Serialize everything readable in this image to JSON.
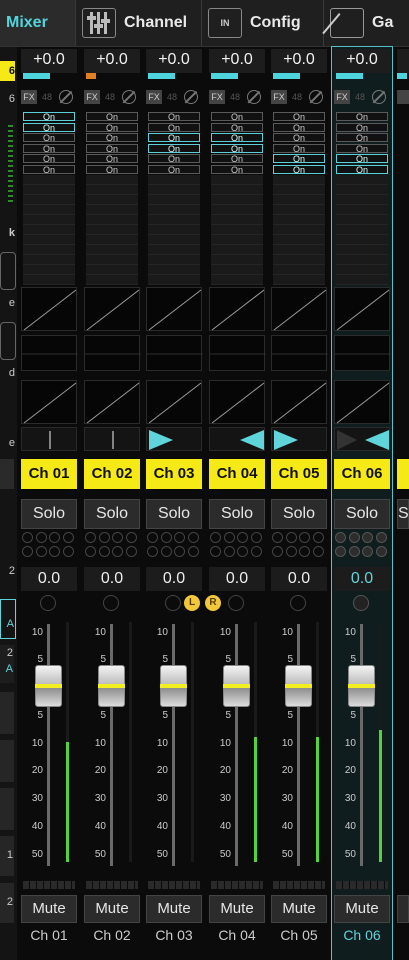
{
  "tabs": [
    {
      "label": "Mixer",
      "icon": "mixer-tab",
      "active": true
    },
    {
      "label": "Channel",
      "icon": "channel-faders-icon",
      "active": false
    },
    {
      "label": "Config",
      "icon": "config-in-icon",
      "active": false
    },
    {
      "label": "Ga",
      "icon": "gain-icon",
      "active": false
    }
  ],
  "config_icon_text": "IN",
  "left_strip": {
    "top_value": "6",
    "labels": [
      "6",
      "k",
      "e",
      "d",
      "e",
      "2",
      "A",
      "2",
      "A",
      "1",
      "2"
    ]
  },
  "colors": {
    "accent": "#52d6dc",
    "channel_name_bg": "#f6ea16",
    "meter_green": "#53d23b",
    "pan_arrow": "#5fd4da",
    "top_meter_cyan": "#4ed4dc",
    "top_meter_orange": "#e67e22"
  },
  "fader_scale": [
    "10",
    "5",
    "0",
    "5",
    "10",
    "20",
    "30",
    "40",
    "50",
    "-"
  ],
  "channels": [
    {
      "name": "Ch 01",
      "footer": "Ch 01",
      "db": "+0.0",
      "value": "0.0",
      "solo": "Solo",
      "mute": "Mute",
      "fx": "FX",
      "p48": "48",
      "meter_color": "cyan",
      "on_labels": [
        "On",
        "On",
        "On",
        "On",
        "On",
        "On"
      ],
      "on_highlight": [
        0,
        1
      ],
      "pan": "center",
      "level_meter": 0.5,
      "fader": 0.72,
      "selected": false
    },
    {
      "name": "Ch 02",
      "footer": "Ch 02",
      "db": "+0.0",
      "value": "0.0",
      "solo": "Solo",
      "mute": "Mute",
      "fx": "FX",
      "p48": "48",
      "meter_color": "orange",
      "on_labels": [
        "On",
        "On",
        "On",
        "On",
        "On",
        "On"
      ],
      "on_highlight": [],
      "pan": "center",
      "level_meter": 0,
      "fader": 0.72,
      "selected": false
    },
    {
      "name": "Ch 03",
      "footer": "Ch 03",
      "db": "+0.0",
      "value": "0.0",
      "solo": "Solo",
      "mute": "Mute",
      "fx": "FX",
      "p48": "48",
      "meter_color": "cyan",
      "on_labels": [
        "On",
        "On",
        "On",
        "On",
        "On",
        "On"
      ],
      "on_highlight": [
        2,
        3
      ],
      "pan": "left",
      "level_meter": 0,
      "fader": 0.72,
      "selected": false,
      "badge": "L"
    },
    {
      "name": "Ch 04",
      "footer": "Ch 04",
      "db": "+0.0",
      "value": "0.0",
      "solo": "Solo",
      "mute": "Mute",
      "fx": "FX",
      "p48": "48",
      "meter_color": "cyan",
      "on_labels": [
        "On",
        "On",
        "On",
        "On",
        "On",
        "On"
      ],
      "on_highlight": [
        2,
        3
      ],
      "pan": "right",
      "level_meter": 0.52,
      "fader": 0.72,
      "selected": false,
      "badge": "R"
    },
    {
      "name": "Ch 05",
      "footer": "Ch 05",
      "db": "+0.0",
      "value": "0.0",
      "solo": "Solo",
      "mute": "Mute",
      "fx": "FX",
      "p48": "48",
      "meter_color": "cyan",
      "on_labels": [
        "On",
        "On",
        "On",
        "On",
        "On",
        "On"
      ],
      "on_highlight": [
        4,
        5
      ],
      "pan": "left",
      "level_meter": 0.52,
      "fader": 0.72,
      "selected": false
    },
    {
      "name": "Ch 06",
      "footer": "Ch 06",
      "db": "+0.0",
      "value": "0.0",
      "solo": "Solo",
      "mute": "Mute",
      "fx": "FX",
      "p48": "48",
      "meter_color": "cyan",
      "on_labels": [
        "On",
        "On",
        "On",
        "On",
        "On",
        "On"
      ],
      "on_highlight": [
        4,
        5
      ],
      "pan": "right",
      "level_meter": 0.55,
      "fader": 0.72,
      "selected": true
    }
  ],
  "partial_channel": {
    "solo": "S"
  }
}
